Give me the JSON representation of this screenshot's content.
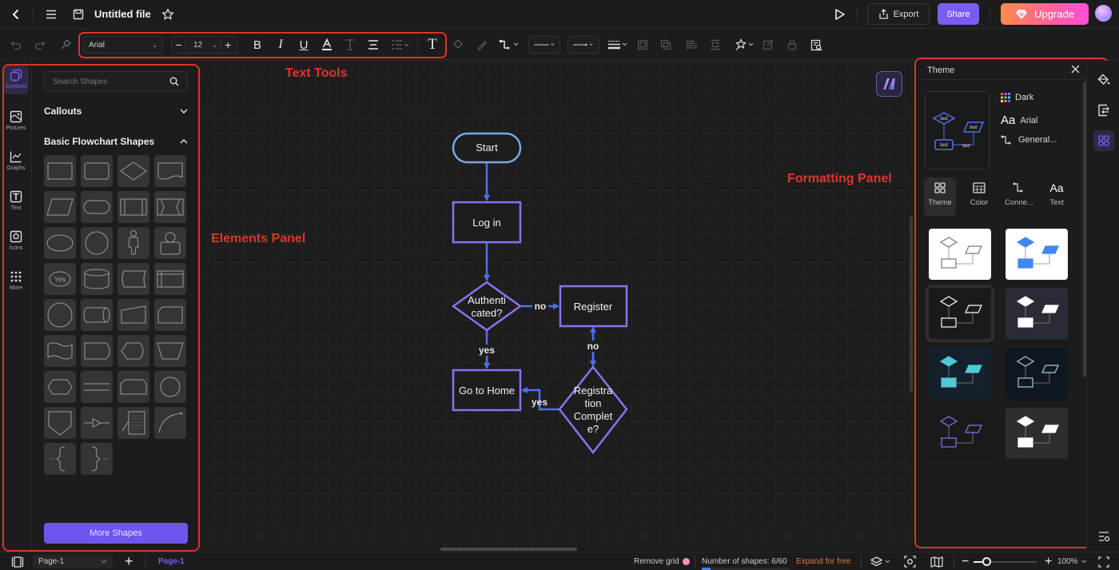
{
  "app": {
    "file_title": "Untitled file",
    "export_label": "Export",
    "share_label": "Share",
    "upgrade_label": "Upgrade",
    "brand_color": "#7a5cf5",
    "annotation_color": "#d9352a"
  },
  "toolbar": {
    "font_family": "Arial",
    "font_size": "12",
    "icons": [
      "undo-icon",
      "redo-icon",
      "format-painter-icon",
      "decrease-font-icon",
      "increase-font-icon",
      "bold-icon",
      "italic-icon",
      "underline-icon",
      "font-color-icon",
      "text-highlight-icon",
      "align-icon",
      "line-spacing-icon",
      "text-box-icon",
      "fill-icon",
      "line-color-icon",
      "connector-icon",
      "line-style-icon",
      "arrow-style-icon",
      "line-weight-icon",
      "bring-front-icon",
      "send-back-icon",
      "align-objects-icon",
      "distribute-icon",
      "effects-icon",
      "edit-icon",
      "lock-icon",
      "find-replace-icon"
    ]
  },
  "rail": {
    "items": [
      {
        "label": "Symbols",
        "icon": "symbols-icon",
        "active": true
      },
      {
        "label": "Pictures",
        "icon": "pictures-icon"
      },
      {
        "label": "Graphs",
        "icon": "graphs-icon"
      },
      {
        "label": "Text",
        "icon": "text-icon"
      },
      {
        "label": "Icons",
        "icon": "icons-icon"
      },
      {
        "label": "More",
        "icon": "more-icon"
      }
    ]
  },
  "shapes_panel": {
    "search_placeholder": "Search Shapes",
    "sections": [
      {
        "title": "Callouts",
        "expanded": false
      },
      {
        "title": "Basic Flowchart Shapes",
        "expanded": true
      }
    ],
    "shape_count": 38,
    "yes_shape_label": "Yes",
    "more_shapes_label": "More Shapes"
  },
  "annotations": {
    "text_tools": "Text Tools",
    "elements_panel": "Elements Panel",
    "formatting_panel": "Formatting Panel"
  },
  "flowchart": {
    "nodes": {
      "start": "Start",
      "login": "Log in",
      "auth_line1": "Authenti",
      "auth_line2": "cated?",
      "register": "Register",
      "home": "Go to Home",
      "reg_line1": "Registra",
      "reg_line2": "tion",
      "reg_line3": "Complet",
      "reg_line4": "e?"
    },
    "edge_labels": {
      "auth_no": "no",
      "auth_yes": "yes",
      "reg_no": "no",
      "reg_yes": "yes"
    },
    "node_stroke": "#8c72f0",
    "terminal_stroke": "#7aa8e6",
    "edge_color": "#4f6ff0"
  },
  "theme_panel": {
    "title": "Theme",
    "current": {
      "color_scheme": "Dark",
      "font": "Arial",
      "connector": "General..."
    },
    "preview_text": "text",
    "tabs": [
      {
        "label": "Theme",
        "active": true
      },
      {
        "label": "Color"
      },
      {
        "label": "Conne..."
      },
      {
        "label": "Text"
      }
    ],
    "swatches": [
      {
        "name": "white-outline",
        "bg": "#ffffff",
        "stroke": "#777777",
        "fill": "none"
      },
      {
        "name": "white-blue",
        "bg": "#ffffff",
        "stroke": "#3f87f5",
        "fill": "#3f87f5"
      },
      {
        "name": "dark-outline",
        "bg": "#1a1a1a",
        "stroke": "#ffffff",
        "fill": "none"
      },
      {
        "name": "slate-filled",
        "bg": "#2a2c35",
        "stroke": "#ffffff",
        "fill": "#ffffff"
      },
      {
        "name": "navy-teal",
        "bg": "#14202c",
        "stroke": "#4fc9d3",
        "fill": "#4fc9d3"
      },
      {
        "name": "navy-outline",
        "bg": "#0f1821",
        "stroke": "#a9c7e8",
        "fill": "none"
      },
      {
        "name": "dark-purple",
        "bg": "#1a1a1a",
        "stroke": "#8c72f0",
        "fill": "none"
      },
      {
        "name": "grey-filled",
        "bg": "#2e2e2e",
        "stroke": "#ffffff",
        "fill": "#ffffff"
      }
    ]
  },
  "bottom": {
    "page_select": "Page-1",
    "active_page_tab": "Page-1",
    "remove_grid": "Remove grid",
    "shape_count_text": "Number of shapes: 6/60",
    "shape_usage_fraction": 0.1,
    "expand_link": "Expand for free",
    "zoom_level": "100%",
    "zoom_fraction": 0.2
  }
}
